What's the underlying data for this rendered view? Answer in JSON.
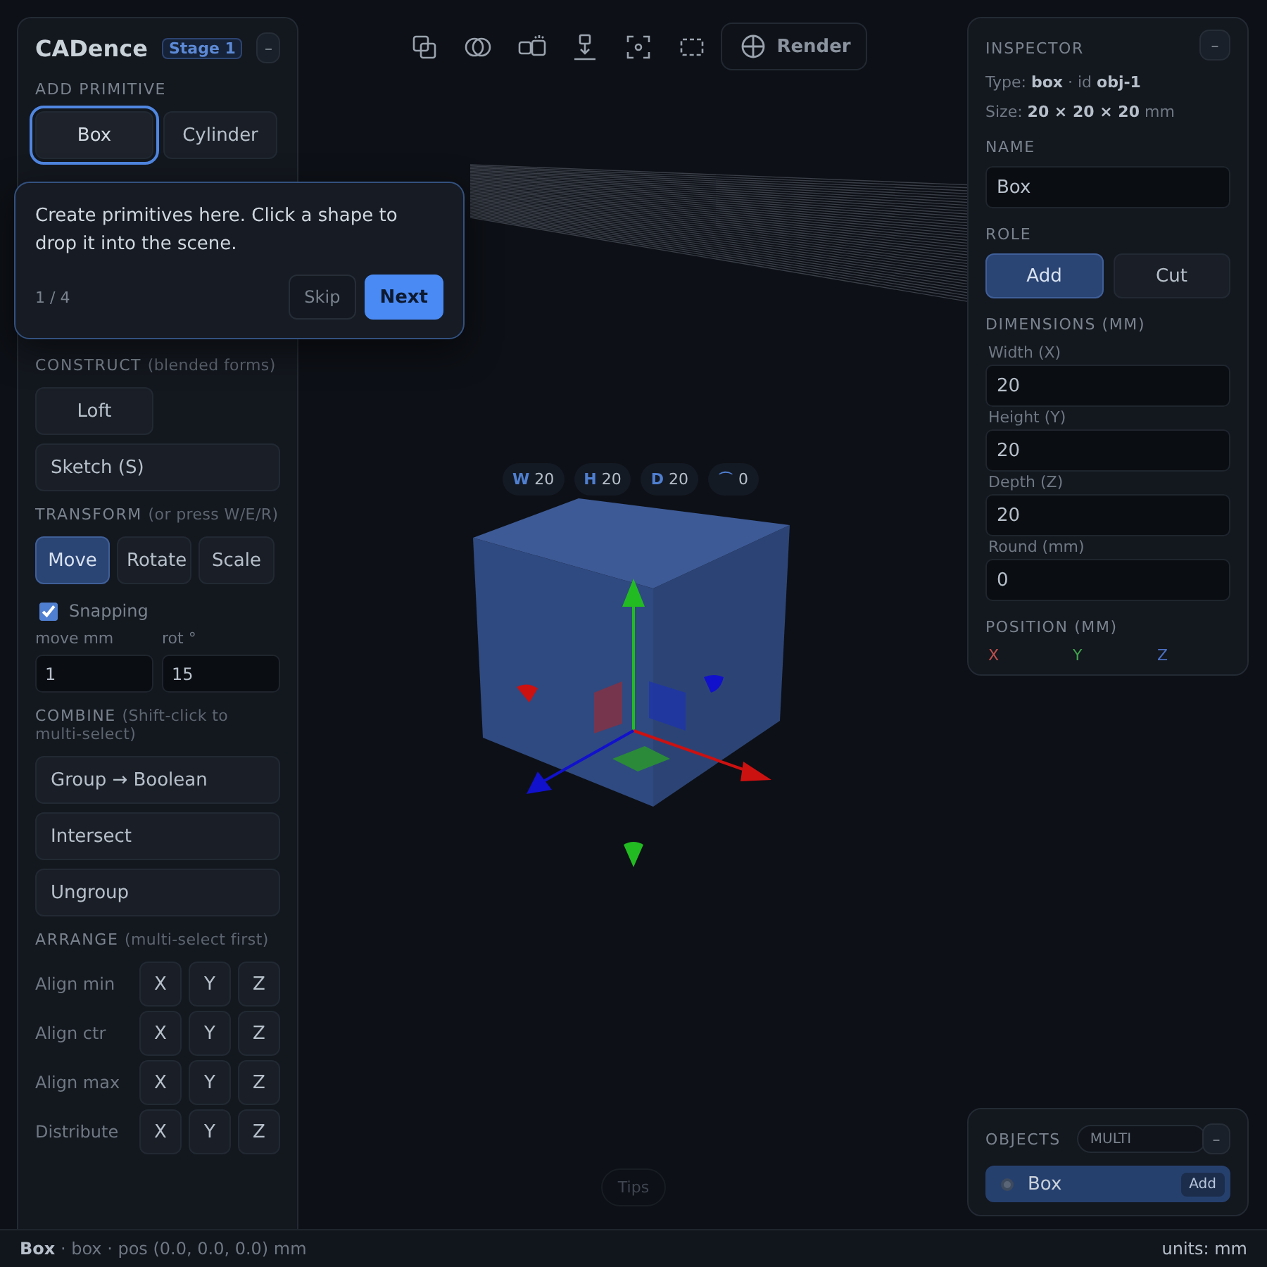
{
  "app": {
    "title": "CADence",
    "badge": "Stage 1",
    "collapse": "–"
  },
  "add_primitive": {
    "heading": "ADD PRIMITIVE",
    "buttons": [
      {
        "label": "Box",
        "selected": true
      },
      {
        "label": "Cylinder",
        "selected": false
      }
    ]
  },
  "construct": {
    "heading": "CONSTRUCT",
    "hint": "(blended forms)",
    "actions": [
      {
        "label": "Loft",
        "kind": "half"
      },
      {
        "label": "Sketch (S)",
        "kind": "wide"
      }
    ]
  },
  "transform": {
    "heading": "TRANSFORM",
    "hint": "(or press W/E/R)",
    "modes": [
      {
        "label": "Move",
        "selected": true
      },
      {
        "label": "Rotate",
        "selected": false
      },
      {
        "label": "Scale",
        "selected": false
      }
    ],
    "snapping": {
      "label": "Snapping",
      "checked": true
    },
    "fields": [
      {
        "label": "move mm",
        "value": "1"
      },
      {
        "label": "rot °",
        "value": "15"
      }
    ]
  },
  "combine": {
    "heading": "COMBINE",
    "hint": "(Shift-click to multi-select)",
    "actions": [
      "Group → Boolean",
      "Intersect",
      "Ungroup"
    ]
  },
  "arrange": {
    "heading": "ARRANGE",
    "hint": "(multi-select first)",
    "rows": [
      {
        "label": "Align min",
        "axes": [
          "X",
          "Y",
          "Z"
        ]
      },
      {
        "label": "Align ctr",
        "axes": [
          "X",
          "Y",
          "Z"
        ]
      },
      {
        "label": "Align max",
        "axes": [
          "X",
          "Y",
          "Z"
        ]
      },
      {
        "label": "Distribute",
        "axes": [
          "X",
          "Y",
          "Z"
        ]
      }
    ]
  },
  "tour": {
    "text": "Create primitives here. Click a shape to drop it into the scene.",
    "step": "1 / 4",
    "buttons": [
      {
        "label": "Skip",
        "kind": "secondary"
      },
      {
        "label": "Next",
        "kind": "primary"
      }
    ]
  },
  "toolbar": {
    "render": "Render"
  },
  "viewport": {
    "chips": [
      {
        "axis": "W",
        "value": "20"
      },
      {
        "axis": "H",
        "value": "20"
      },
      {
        "axis": "D",
        "value": "20"
      },
      {
        "axis": "⌒",
        "value": "0"
      }
    ],
    "tips": "Tips"
  },
  "inspector": {
    "title": "INSPECTOR",
    "collapse": "–",
    "type_line": "Type: **box** · id **obj-1**",
    "size_line": "Size: **20 × 20 × 20** mm",
    "name": {
      "heading": "NAME",
      "value": "Box"
    },
    "role": {
      "heading": "ROLE",
      "options": [
        {
          "label": "Add",
          "selected": true
        },
        {
          "label": "Cut",
          "selected": false
        }
      ]
    },
    "dimensions": {
      "heading": "DIMENSIONS (MM)",
      "fields": [
        {
          "label": "Width (X)",
          "value": "20"
        },
        {
          "label": "Height (Y)",
          "value": "20"
        },
        {
          "label": "Depth (Z)",
          "value": "20"
        },
        {
          "label": "Round (mm)",
          "value": "0"
        }
      ]
    },
    "position": {
      "heading": "POSITION (MM)",
      "axes": [
        {
          "label": "X",
          "color": "#c0504d"
        },
        {
          "label": "Y",
          "color": "#3fa34d"
        },
        {
          "label": "Z",
          "color": "#4a6fc0"
        }
      ]
    }
  },
  "objects": {
    "title": "OBJECTS",
    "multi": "MULTI",
    "collapse": "–",
    "items": [
      {
        "name": "Box",
        "role": "Add",
        "selected": true
      }
    ]
  },
  "status_bar": {
    "left": "**Box** · box · pos (0.0, 0.0, 0.0) mm",
    "right": "units: mm"
  }
}
